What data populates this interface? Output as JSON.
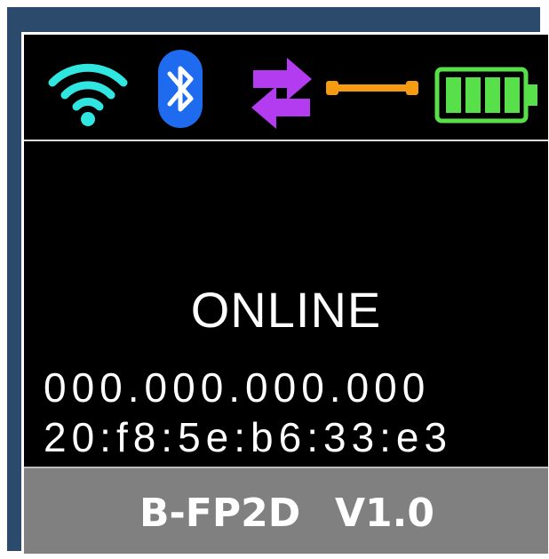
{
  "status": {
    "icons": [
      "wifi-icon",
      "bluetooth-icon",
      "transfer-icon",
      "cable-icon",
      "battery-icon"
    ],
    "colors": {
      "wifi": "#2fe7e0",
      "bluetooth": "#1e6bf0",
      "transfer": "#b43cf0",
      "cable": "#f59b12",
      "battery": "#57e04a"
    },
    "battery_level": 4
  },
  "main": {
    "state": "ONLINE",
    "ip_address": "000.000.000.000",
    "mac_address": "20:f8:5e:b6:33:e3"
  },
  "footer": {
    "model": "B-FP2D",
    "version": "V1.0"
  }
}
